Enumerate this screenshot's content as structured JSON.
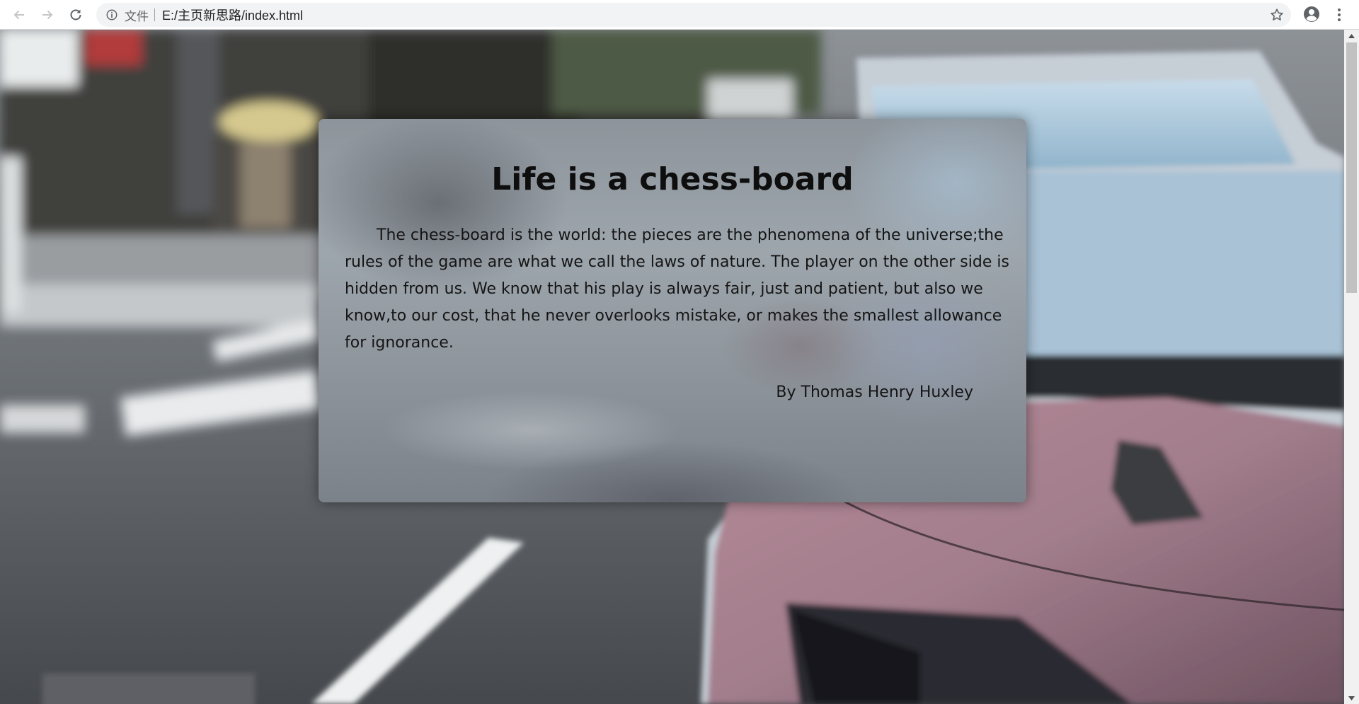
{
  "browser": {
    "scheme_label": "文件",
    "url": "E:/主页新思路/index.html",
    "back_icon": "arrow-left-icon",
    "forward_icon": "arrow-right-icon",
    "reload_icon": "reload-icon",
    "info_icon": "info-icon",
    "bookmark_icon": "star-icon",
    "profile_icon": "account-icon",
    "menu_icon": "kebab-menu-icon"
  },
  "card": {
    "title": "Life is a chess-board",
    "body": "The chess-board is the world: the pieces are the phenomena of the universe;the rules of the game are what we call the laws of nature. The player on the other side is hidden from us. We know that his play is always fair, just and patient, but also we know,to our cost, that he never overlooks mistake, or makes the smallest allowance for ignorance.",
    "author": "By Thomas Henry Huxley"
  },
  "colors": {
    "title_text": "#0e0e0e",
    "body_text": "#151515",
    "chrome_bg": "#ffffff",
    "omnibox_bg": "#f1f3f4"
  }
}
